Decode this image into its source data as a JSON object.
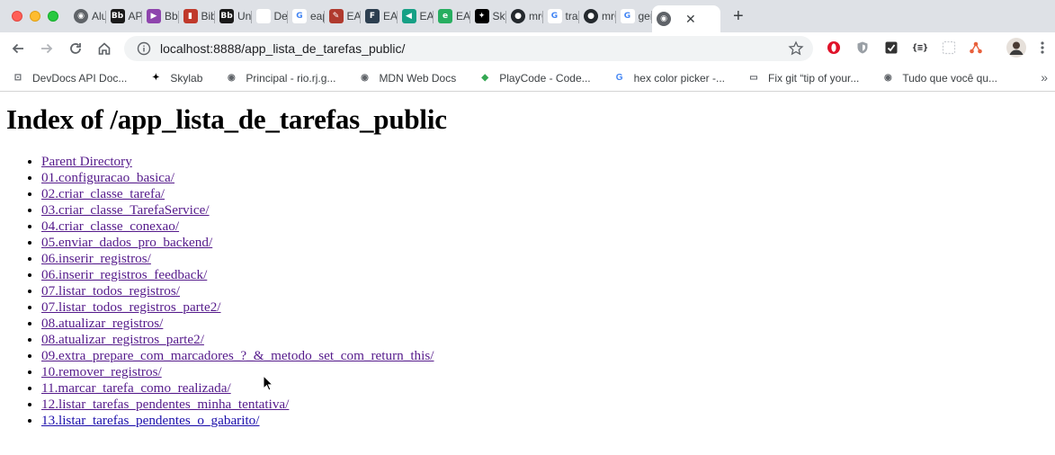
{
  "browser": {
    "tabs": [
      {
        "title": "Alur",
        "icon": "globe-icon",
        "color": "#5f6368"
      },
      {
        "title": "APS",
        "icon": "bb-icon",
        "color": "#1a1a1a"
      },
      {
        "title": "Bb",
        "icon": "play-icon",
        "color": "#8e44ad"
      },
      {
        "title": "Bib",
        "icon": "book-icon",
        "color": "#c0392b"
      },
      {
        "title": "Uni",
        "icon": "bb-icon",
        "color": "#1a1a1a"
      },
      {
        "title": "Def",
        "icon": "blank-icon",
        "color": "#ffffff"
      },
      {
        "title": "eap",
        "icon": "google-icon",
        "color": "#4285f4"
      },
      {
        "title": "EAF",
        "icon": "quill-icon",
        "color": "#b03a2e"
      },
      {
        "title": "EAF",
        "icon": "fmu-icon",
        "color": "#2c3e50"
      },
      {
        "title": "EAF",
        "icon": "arrow-icon",
        "color": "#16a085"
      },
      {
        "title": "EAF",
        "icon": "e-icon",
        "color": "#27ae60"
      },
      {
        "title": "Sky",
        "icon": "skylab-icon",
        "color": "#000000"
      },
      {
        "title": "mrC",
        "icon": "github-icon",
        "color": "#24292e"
      },
      {
        "title": "trac",
        "icon": "google-icon",
        "color": "#4285f4"
      },
      {
        "title": "mrC",
        "icon": "github-icon",
        "color": "#24292e"
      },
      {
        "title": "ger",
        "icon": "google-icon",
        "color": "#4285f4"
      }
    ],
    "active_tab": {
      "title": "",
      "icon": "globe-icon"
    },
    "url": "localhost:8888/app_lista_de_tarefas_public/",
    "bookmarks": [
      {
        "label": "DevDocs API Doc...",
        "icon": "devdocs-icon"
      },
      {
        "label": "Skylab",
        "icon": "skylab-icon"
      },
      {
        "label": "Principal - rio.rj.g...",
        "icon": "globe-icon"
      },
      {
        "label": "MDN Web Docs",
        "icon": "globe-icon"
      },
      {
        "label": "PlayCode - Code...",
        "icon": "playcode-icon"
      },
      {
        "label": "hex color picker -...",
        "icon": "google-icon"
      },
      {
        "label": "Fix git “tip of your...",
        "icon": "laptop-icon"
      },
      {
        "label": "Tudo que você qu...",
        "icon": "globe-icon"
      }
    ]
  },
  "page": {
    "title": "Index of /app_lista_de_tarefas_public",
    "entries": [
      {
        "label": "Parent Directory",
        "visited": true
      },
      {
        "label": "01.configuracao_basica/",
        "visited": true
      },
      {
        "label": "02.criar_classe_tarefa/",
        "visited": true
      },
      {
        "label": "03.criar_classe_TarefaService/",
        "visited": true
      },
      {
        "label": "04.criar_classe_conexao/",
        "visited": true
      },
      {
        "label": "05.enviar_dados_pro_backend/",
        "visited": true
      },
      {
        "label": "06.inserir_registros/",
        "visited": true
      },
      {
        "label": "06.inserir_registros_feedback/",
        "visited": true
      },
      {
        "label": "07.listar_todos_registros/",
        "visited": true
      },
      {
        "label": "07.listar_todos_registros_parte2/",
        "visited": true
      },
      {
        "label": "08.atualizar_registros/",
        "visited": true
      },
      {
        "label": "08.atualizar_registros_parte2/",
        "visited": true
      },
      {
        "label": "09.extra_prepare_com_marcadores_?_&_metodo_set_com_return_this/",
        "visited": true
      },
      {
        "label": "10.remover_registros/",
        "visited": true
      },
      {
        "label": "11.marcar_tarefa_como_realizada/",
        "visited": true
      },
      {
        "label": "12.listar_tarefas_pendentes_minha_tentativa/",
        "visited": true
      },
      {
        "label": "13.listar_tarefas_pendentes_o_gabarito/",
        "visited": false
      }
    ]
  }
}
